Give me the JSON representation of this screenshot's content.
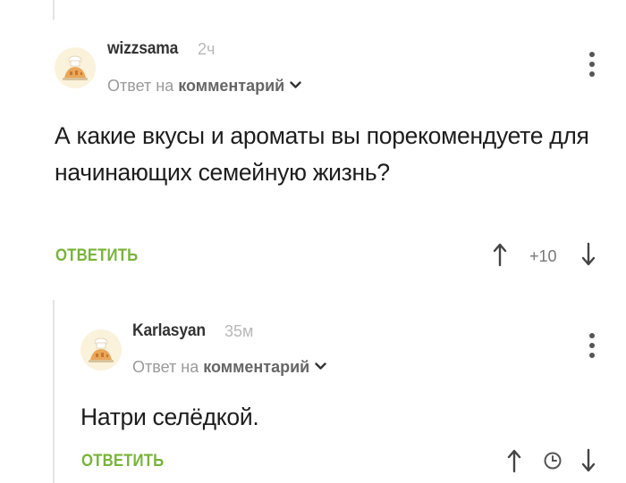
{
  "comments": [
    {
      "username": "wizzsama",
      "time": "2ч",
      "reply_prefix": "Ответ на",
      "reply_target": "комментарий",
      "text": "А какие вкусы и ароматы вы порекомендуете для начинающих семейную жизнь?",
      "reply_label": "ОТВЕТИТЬ",
      "rating": "+10"
    },
    {
      "username": "Karlasyan",
      "time": "35м",
      "reply_prefix": "Ответ на",
      "reply_target": "комментарий",
      "text": "Натри селёдкой.",
      "reply_label": "ОТВЕТИТЬ"
    }
  ],
  "colors": {
    "accent_green": "#79b33a",
    "avatar_bg": "#fbf2dc",
    "thread_line": "#e4e4e4"
  },
  "icons": [
    "chef-avatar-icon",
    "chevron-down-icon",
    "more-vertical-icon",
    "arrow-up-icon",
    "arrow-down-icon",
    "clock-icon"
  ]
}
